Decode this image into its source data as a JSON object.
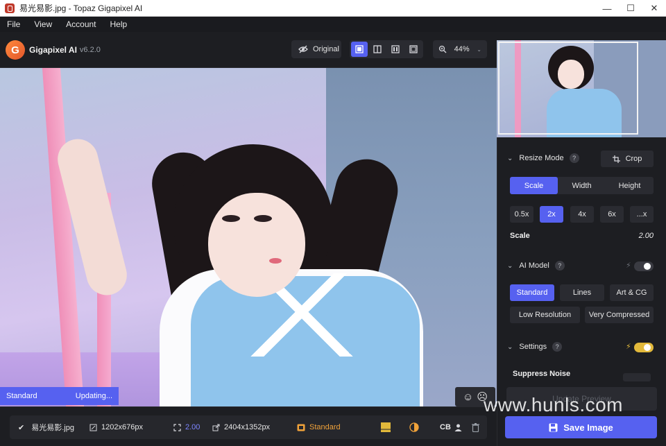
{
  "window": {
    "title": "易光易影.jpg - Topaz Gigapixel AI",
    "min": "—",
    "max": "☐",
    "close": "✕"
  },
  "menu": {
    "file": "File",
    "view": "View",
    "account": "Account",
    "help": "Help"
  },
  "brand": {
    "name": "Gigapixel AI",
    "version": "v6.2.0",
    "logo_letter": "G"
  },
  "toolbar": {
    "original_label": "Original",
    "zoom_value": "44%"
  },
  "preview": {
    "model_label": "Standard",
    "status_label": "Updating..."
  },
  "panel": {
    "resize_mode": {
      "title": "Resize Mode",
      "crop_label": "Crop",
      "tabs": [
        {
          "label": "Scale",
          "active": true
        },
        {
          "label": "Width",
          "active": false
        },
        {
          "label": "Height",
          "active": false
        }
      ],
      "scale_options": [
        "0.5x",
        "2x",
        "4x",
        "6x",
        "...x"
      ],
      "active_scale": "2x",
      "scale_label": "Scale",
      "scale_value": "2.00"
    },
    "ai_model": {
      "title": "AI Model",
      "models": [
        "Standard",
        "Lines",
        "Art & CG",
        "Low Resolution",
        "Very Compressed"
      ],
      "active_model": "Standard"
    },
    "settings": {
      "title": "Settings",
      "suppress_noise_label": "Suppress Noise"
    },
    "update_preview_label": "Update Preview"
  },
  "bottom": {
    "filename": "易光易影.jpg",
    "input_size": "1202x676px",
    "scale": "2.00",
    "output_size": "2404x1352px",
    "model": "Standard",
    "cb_label": "CB",
    "save_label": "Save Image"
  },
  "watermark": "www.hunls.com",
  "colors": {
    "accent": "#5661f0",
    "toggle_on": "#e2b93b",
    "model_orange": "#f0a23a"
  }
}
